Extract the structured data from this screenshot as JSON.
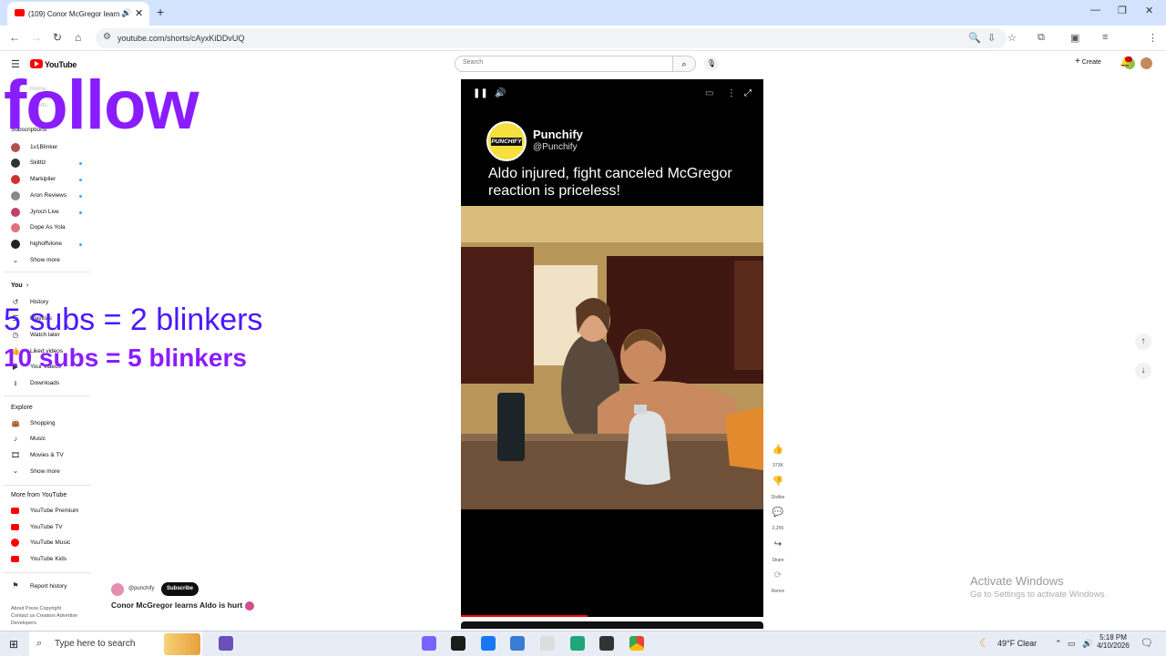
{
  "browser": {
    "tab_title": "(109) Conor McGregor learns Aldo is hurt",
    "url": "youtube.com/shorts/cAyxKiDDvUQ",
    "new_tab": "+",
    "close": "✕",
    "minimize": "—",
    "restore": "❐",
    "close_window": "✕"
  },
  "yt": {
    "logo_text": "YouTube",
    "search_placeholder": "Search",
    "create_label": "Create",
    "notif_count": "9+"
  },
  "sidebar": {
    "home": "Home",
    "shorts": "Shorts",
    "subscriptions_header": "Subscriptions",
    "subscriptions": [
      {
        "name": "1v1Blinker",
        "color": "#b05050"
      },
      {
        "name": "Skittlz",
        "color": "#333"
      },
      {
        "name": "Markiplier",
        "color": "#d03030"
      },
      {
        "name": "Aron Reviews",
        "color": "#888"
      },
      {
        "name": "Jynxzi Live",
        "color": "#c04070"
      },
      {
        "name": "Dope As Yola",
        "color": "#e07080"
      },
      {
        "name": "highoffvlone",
        "color": "#222"
      }
    ],
    "show_more": "Show more",
    "you_header": "You",
    "you_items": [
      "History",
      "Playlists",
      "Watch later",
      "Liked videos",
      "Your videos",
      "Downloads"
    ],
    "explore_header": "Explore",
    "explore_items": [
      "Shopping",
      "Music",
      "Movies & TV"
    ],
    "show_more_2": "Show more",
    "more_header": "More from YouTube",
    "more_items": [
      "YouTube Premium",
      "YouTube TV",
      "YouTube Music",
      "YouTube Kids"
    ],
    "report_history": "Report history",
    "footer_1": "About  Press  Copyright",
    "footer_2": "Contact us  Creators  Advertise",
    "footer_3": "Developers"
  },
  "overlay": {
    "follow": "follow",
    "subs_line_1": "5 subs = 2 blinkers",
    "subs_line_2": "10 subs = 5 blinkers"
  },
  "short": {
    "channel_name": "Punchify",
    "channel_handle": "@Punchify",
    "logo_text": "PUNCHIFY",
    "headline": "Aldo injured, fight canceled McGregor reaction is priceless!",
    "meta_handle": "@punchify",
    "subscribe_label": "Subscribe",
    "title": "Conor McGregor learns Aldo is hurt",
    "progress": 0.42
  },
  "actions": {
    "like_count": "373K",
    "dislike_label": "Dislike",
    "comment_count": "2,256",
    "share_label": "Share",
    "remix_label": "Remix"
  },
  "windows": {
    "activate_title": "Activate Windows",
    "activate_sub": "Go to Settings to activate Windows.",
    "search_text": "Type here to search",
    "weather": "49°F  Clear",
    "time": "5:18 PM",
    "date": "4/10/2026"
  }
}
